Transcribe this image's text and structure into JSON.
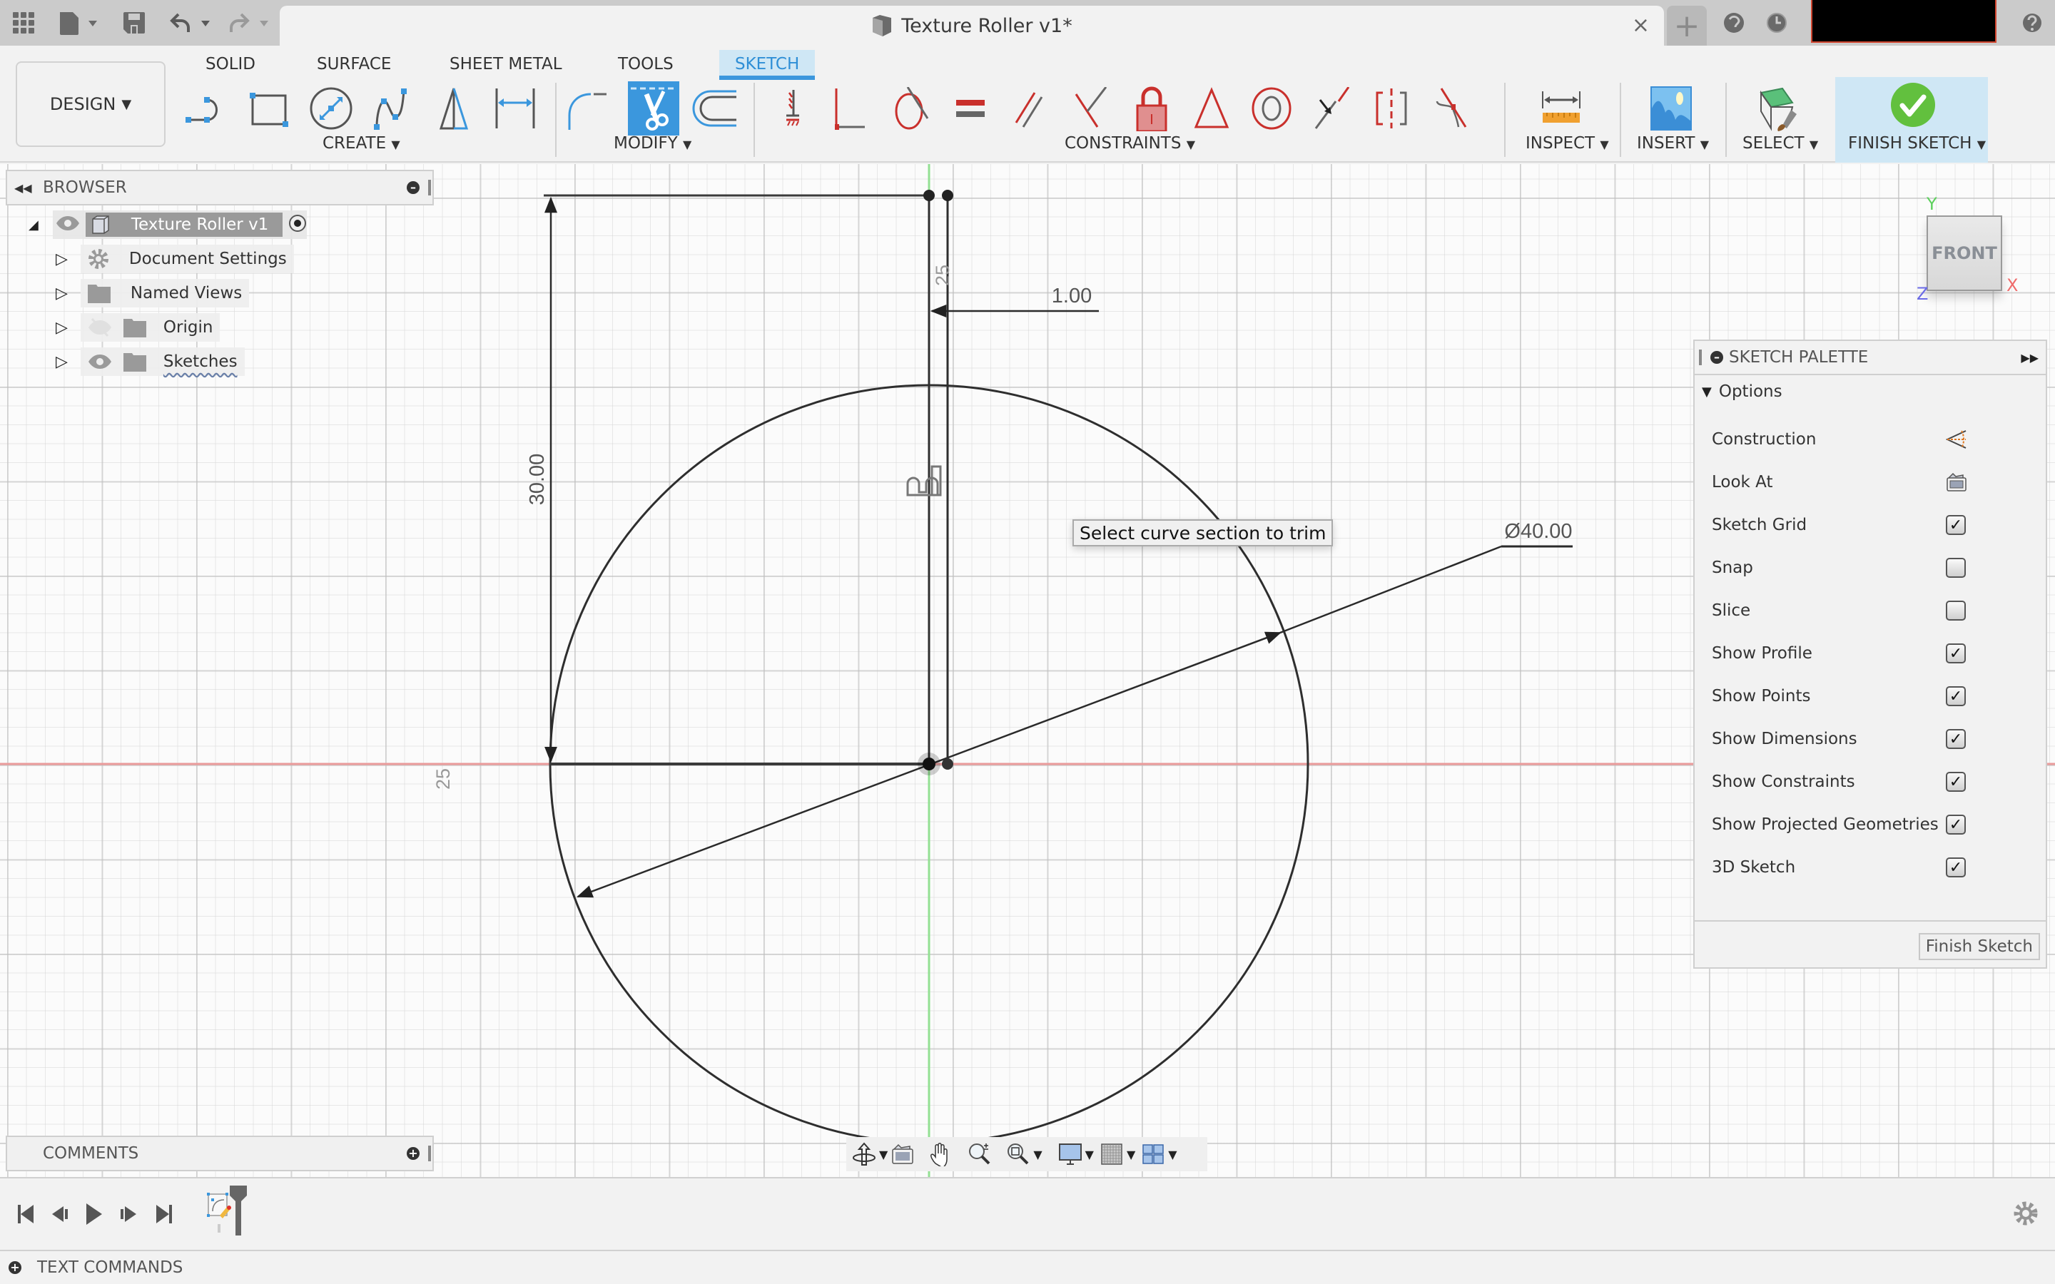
{
  "window": {
    "document_title": "Texture Roller v1*",
    "user_area_redacted": true
  },
  "titlebar": {
    "icons": [
      "apps-grid-icon",
      "file-icon",
      "save-icon",
      "undo-icon",
      "redo-icon"
    ],
    "close_glyph": "×",
    "new_tab_glyph": "+",
    "right_icons": [
      "job-status-icon",
      "notifications-clock-icon",
      "help-icon"
    ]
  },
  "ribbon": {
    "workspace_label": "DESIGN",
    "tabs": [
      {
        "label": "SOLID",
        "active": false
      },
      {
        "label": "SURFACE",
        "active": false
      },
      {
        "label": "SHEET METAL",
        "active": false
      },
      {
        "label": "TOOLS",
        "active": false
      },
      {
        "label": "SKETCH",
        "active": true
      }
    ],
    "groups": {
      "create": {
        "label": "CREATE",
        "tools": [
          "line",
          "rectangle",
          "circle",
          "spline",
          "mirror",
          "sketch-dimension"
        ]
      },
      "modify": {
        "label": "MODIFY",
        "tools": [
          "fillet",
          "trim",
          "offset"
        ],
        "active_tool": "trim"
      },
      "constraints": {
        "label": "CONSTRAINTS",
        "tools": [
          "fix",
          "coincident-perpendicular",
          "tangent",
          "equal",
          "parallel",
          "perpendicular",
          "lock",
          "triangle",
          "concentric",
          "midpoint",
          "symmetry",
          "curvature"
        ]
      },
      "inspect": {
        "label": "INSPECT"
      },
      "insert": {
        "label": "INSERT"
      },
      "select": {
        "label": "SELECT"
      },
      "finish": {
        "label": "FINISH SKETCH"
      }
    },
    "accent": "#3b97dd"
  },
  "browser": {
    "title": "BROWSER",
    "root": {
      "label": "Texture Roller v1",
      "visible": true
    },
    "items": [
      {
        "label": "Document Settings",
        "icon": "gear-icon",
        "visible": null
      },
      {
        "label": "Named Views",
        "icon": "folder-icon",
        "visible": null
      },
      {
        "label": "Origin",
        "icon": "folder-icon",
        "visible": false
      },
      {
        "label": "Sketches",
        "icon": "folder-icon",
        "visible": true
      }
    ]
  },
  "comments": {
    "title": "COMMENTS"
  },
  "sketch": {
    "dimensions": {
      "height": "30.00",
      "offset": "1.00",
      "diameter": "Ø40.00",
      "ruler_top": "25",
      "ruler_left": "25"
    },
    "tooltip": "Select curve section to trim",
    "axis_colors": {
      "x": "#e35d5d",
      "y": "#62d162"
    }
  },
  "viewcube": {
    "face": "FRONT",
    "axes": {
      "x": "X",
      "y": "Y",
      "z": "Z"
    }
  },
  "palette": {
    "title": "SKETCH PALETTE",
    "section": "Options",
    "rows": [
      {
        "label": "Construction",
        "type": "icon",
        "icon": "construction-icon"
      },
      {
        "label": "Look At",
        "type": "icon",
        "icon": "look-at-icon"
      },
      {
        "label": "Sketch Grid",
        "type": "checkbox",
        "checked": true
      },
      {
        "label": "Snap",
        "type": "checkbox",
        "checked": false
      },
      {
        "label": "Slice",
        "type": "checkbox",
        "checked": false
      },
      {
        "label": "Show Profile",
        "type": "checkbox",
        "checked": true
      },
      {
        "label": "Show Points",
        "type": "checkbox",
        "checked": true
      },
      {
        "label": "Show Dimensions",
        "type": "checkbox",
        "checked": true
      },
      {
        "label": "Show Constraints",
        "type": "checkbox",
        "checked": true
      },
      {
        "label": "Show Projected Geometries",
        "type": "checkbox",
        "checked": true
      },
      {
        "label": "3D Sketch",
        "type": "checkbox",
        "checked": true
      }
    ],
    "finish_button": "Finish Sketch"
  },
  "navbar": {
    "items": [
      "orbit-icon",
      "look-at-icon",
      "pan-icon",
      "zoom-icon",
      "fit-icon",
      "display-settings-icon",
      "grid-settings-icon",
      "viewports-icon"
    ]
  },
  "timeline": {
    "controls": [
      "first",
      "previous",
      "play",
      "next",
      "last"
    ],
    "features": [
      "sketch-feature"
    ]
  },
  "text_commands": {
    "title": "TEXT COMMANDS"
  },
  "checkmark_glyph": "✓"
}
